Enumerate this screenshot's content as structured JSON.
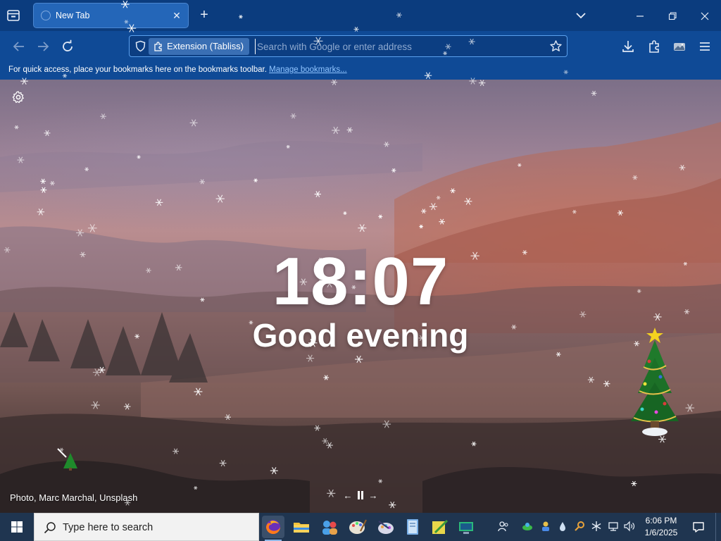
{
  "tabstrip": {
    "tab_title": "New Tab"
  },
  "navbar": {
    "extension_label": "Extension (Tabliss)",
    "address_placeholder": "Search with Google or enter address"
  },
  "bookmarks_bar": {
    "hint": "For quick access, place your bookmarks here on the bookmarks toolbar.",
    "manage_link": "Manage bookmarks..."
  },
  "page": {
    "time": "18:07",
    "greeting": "Good evening",
    "photo_credit": "Photo, Marc Marchal, Unsplash"
  },
  "taskbar": {
    "search_placeholder": "Type here to search",
    "time": "6:06 PM",
    "date": "1/6/2025"
  },
  "colors": {
    "tabstrip": "#0b3c7e",
    "toolbar": "#0f4a96",
    "active_tab": "#2466b8",
    "link": "#8fc4ff",
    "taskbar": "#1f3550"
  }
}
